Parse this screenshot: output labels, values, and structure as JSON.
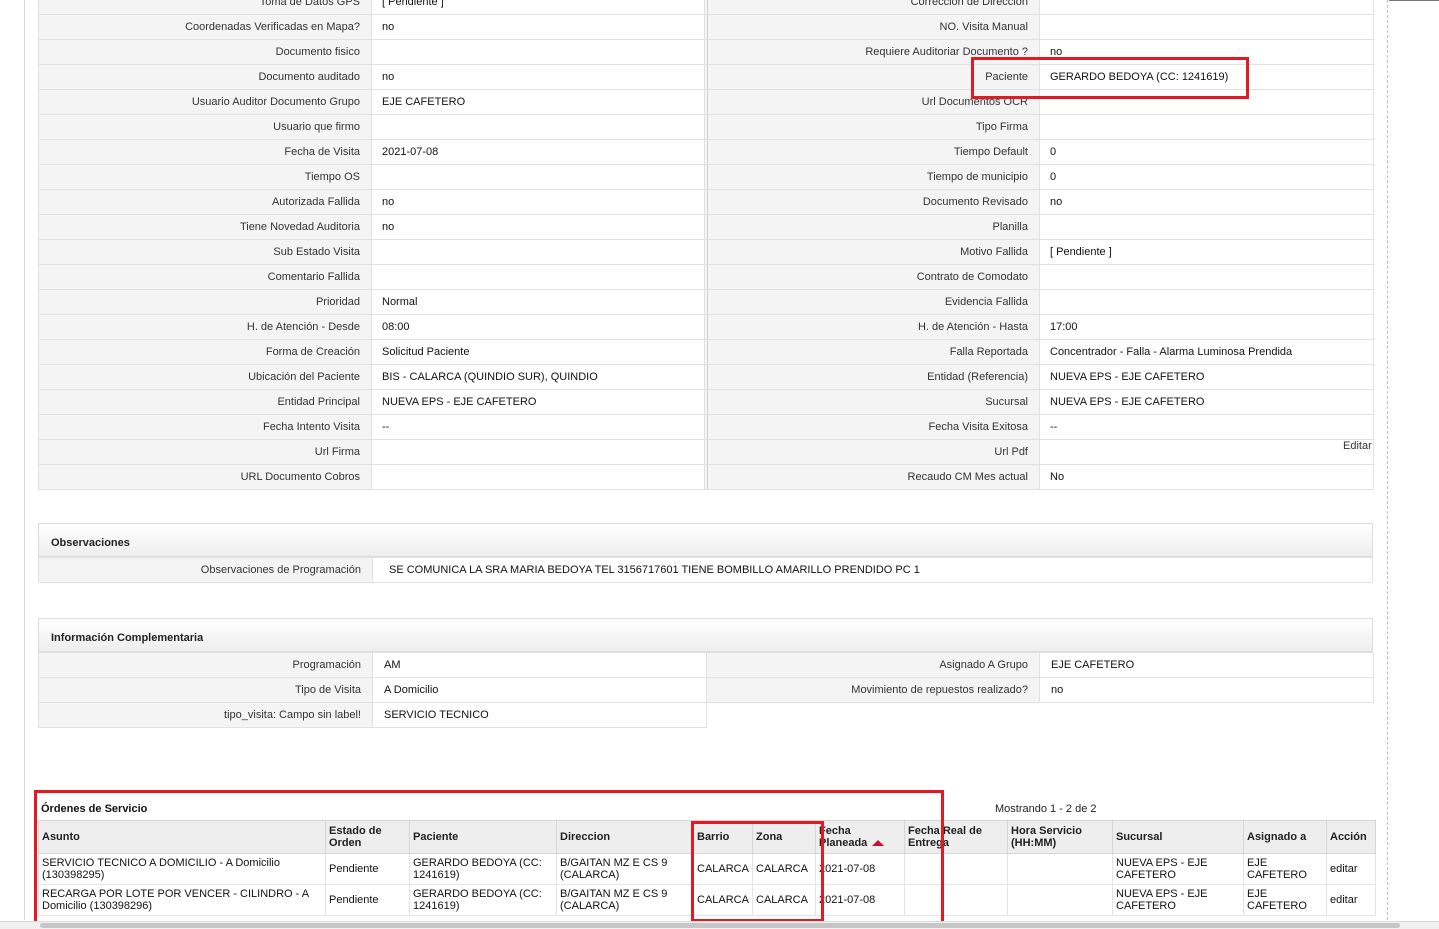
{
  "details": {
    "rows": [
      {
        "l1": "Toma de Datos GPS",
        "v1": "[ Pendiente ]",
        "l2": "Corrección de Dirección",
        "v2": ""
      },
      {
        "l1": "Coordenadas Verificadas en Mapa?",
        "v1": "no",
        "l2": "NO. Visita Manual",
        "v2": ""
      },
      {
        "l1": "Documento fisico",
        "v1": "",
        "l2": "Requiere Auditoriar Documento ?",
        "v2": "no"
      },
      {
        "l1": "Documento auditado",
        "v1": "no",
        "l2": "Paciente",
        "v2": "GERARDO BEDOYA (CC: 1241619)"
      },
      {
        "l1": "Usuario Auditor Documento Grupo",
        "v1": "EJE CAFETERO",
        "l2": "Url Documentos OCR",
        "v2": ""
      },
      {
        "l1": "Usuario que firmo",
        "v1": "",
        "l2": "Tipo Firma",
        "v2": ""
      },
      {
        "l1": "Fecha de Visita",
        "v1": "2021-07-08",
        "l2": "Tiempo Default",
        "v2": "0"
      },
      {
        "l1": "Tiempo OS",
        "v1": "",
        "l2": "Tiempo de municipio",
        "v2": "0"
      },
      {
        "l1": "Autorizada Fallida",
        "v1": "no",
        "l2": "Documento Revisado",
        "v2": "no"
      },
      {
        "l1": "Tiene Novedad Auditoria",
        "v1": "no",
        "l2": "Planilla",
        "v2": ""
      },
      {
        "l1": "Sub Estado Visita",
        "v1": "",
        "l2": "Motivo Fallida",
        "v2": "[ Pendiente ]"
      },
      {
        "l1": "Comentario Fallida",
        "v1": "",
        "l2": "Contrato de Comodato",
        "v2": ""
      },
      {
        "l1": "Prioridad",
        "v1": "Normal",
        "l2": "Evidencia Fallida",
        "v2": ""
      },
      {
        "l1": "H. de Atención - Desde",
        "v1": "08:00",
        "l2": "H. de Atención - Hasta",
        "v2": "17:00"
      },
      {
        "l1": "Forma de Creación",
        "v1": "Solicitud Paciente",
        "l2": "Falla Reportada",
        "v2": "Concentrador - Falla - Alarma Luminosa Prendida"
      },
      {
        "l1": "Ubicación del Paciente",
        "v1": "BIS - CALARCA (QUINDIO SUR), QUINDIO",
        "l2": "Entidad (Referencia)",
        "v2": "NUEVA EPS - EJE CAFETERO"
      },
      {
        "l1": "Entidad Principal",
        "v1": "NUEVA EPS - EJE CAFETERO",
        "l2": "Sucursal",
        "v2": "NUEVA EPS - EJE CAFETERO"
      },
      {
        "l1": "Fecha Intento Visita",
        "v1": "--",
        "l2": "Fecha Visita Exitosa",
        "v2": "--"
      },
      {
        "l1": "Url Firma",
        "v1": "",
        "l2": "Url Pdf",
        "v2": ""
      },
      {
        "l1": "URL Documento Cobros",
        "v1": "",
        "l2": "Recaudo CM Mes actual",
        "v2": "No"
      }
    ],
    "edit_link": "Editar"
  },
  "observaciones": {
    "title": "Observaciones",
    "label": "Observaciones de Programación",
    "value": "SE COMUNICA LA SRA MARIA BEDOYA TEL 3156717601 TIENE BOMBILLO AMARILLO PRENDIDO PC 1"
  },
  "complementaria": {
    "title": "Información Complementaria",
    "rows": [
      {
        "l1": "Programación",
        "v1": "AM",
        "l2": "Asignado A Grupo",
        "v2": "EJE CAFETERO"
      },
      {
        "l1": "Tipo de Visita",
        "v1": "A Domicilio",
        "l2": "Movimiento de repuestos realizado?",
        "v2": "no"
      },
      {
        "l1": "tipo_visita: Campo sin label!",
        "v1": "SERVICIO TECNICO",
        "l2": null,
        "v2": null
      }
    ]
  },
  "ordenes": {
    "title": "Órdenes de Servicio",
    "count": "Mostrando 1 - 2 de 2",
    "headers": [
      "Asunto",
      "Estado de Orden",
      "Paciente",
      "Direccion",
      "Barrio",
      "Zona",
      "Fecha Planeada",
      "Fecha Real de Entrega",
      "Hora Servicio (HH:MM)",
      "Sucursal",
      "Asignado a",
      "Acción"
    ],
    "rows": [
      [
        "SERVICIO TECNICO A DOMICILIO - A Domicilio (130398295)",
        "Pendiente",
        "GERARDO BEDOYA (CC: 1241619)",
        "B/GAITAN MZ E CS 9 (CALARCA)",
        "CALARCA",
        "CALARCA",
        "2021-07-08",
        "",
        "",
        "NUEVA EPS - EJE CAFETERO",
        "EJE CAFETERO",
        "editar"
      ],
      [
        "RECARGA POR LOTE POR VENCER - CILINDRO - A Domicilio (130398296)",
        "Pendiente",
        "GERARDO BEDOYA (CC: 1241619)",
        "B/GAITAN MZ E CS 9 (CALARCA)",
        "CALARCA",
        "CALARCA",
        "2021-07-08",
        "",
        "",
        "NUEVA EPS - EJE CAFETERO",
        "EJE CAFETERO",
        "editar"
      ]
    ]
  },
  "colors": {
    "highlight": "#e01b24",
    "sort_arrow": "#c8102e"
  }
}
